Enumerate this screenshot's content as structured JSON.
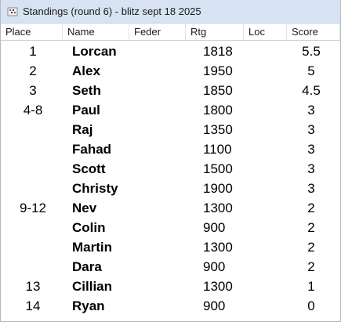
{
  "window": {
    "title": "Standings  (round 6) - blitz sept 18 2025"
  },
  "columns": {
    "place": "Place",
    "name": "Name",
    "feder": "Feder",
    "rtg": "Rtg",
    "loc": "Loc",
    "score": "Score"
  },
  "rows": [
    {
      "place": "1",
      "name": "Lorcan",
      "feder": "",
      "rtg": "1818",
      "loc": "",
      "score": "5.5"
    },
    {
      "place": "2",
      "name": "Alex",
      "feder": "",
      "rtg": "1950",
      "loc": "",
      "score": "5"
    },
    {
      "place": "3",
      "name": "Seth",
      "feder": "",
      "rtg": "1850",
      "loc": "",
      "score": "4.5"
    },
    {
      "place": "4-8",
      "name": "Paul",
      "feder": "",
      "rtg": "1800",
      "loc": "",
      "score": "3"
    },
    {
      "place": "",
      "name": "Raj",
      "feder": "",
      "rtg": "1350",
      "loc": "",
      "score": "3"
    },
    {
      "place": "",
      "name": "Fahad",
      "feder": "",
      "rtg": "1100",
      "loc": "",
      "score": "3"
    },
    {
      "place": "",
      "name": "Scott",
      "feder": "",
      "rtg": "1500",
      "loc": "",
      "score": "3"
    },
    {
      "place": "",
      "name": "Christy",
      "feder": "",
      "rtg": "1900",
      "loc": "",
      "score": "3"
    },
    {
      "place": "9-12",
      "name": "Nev",
      "feder": "",
      "rtg": "1300",
      "loc": "",
      "score": "2"
    },
    {
      "place": "",
      "name": "Colin",
      "feder": "",
      "rtg": "900",
      "loc": "",
      "score": "2"
    },
    {
      "place": "",
      "name": "Martin",
      "feder": "",
      "rtg": "1300",
      "loc": "",
      "score": "2"
    },
    {
      "place": "",
      "name": "Dara",
      "feder": "",
      "rtg": "900",
      "loc": "",
      "score": "2"
    },
    {
      "place": "13",
      "name": "Cillian",
      "feder": "",
      "rtg": "1300",
      "loc": "",
      "score": "1"
    },
    {
      "place": "14",
      "name": "Ryan",
      "feder": "",
      "rtg": "900",
      "loc": "",
      "score": "0"
    }
  ]
}
